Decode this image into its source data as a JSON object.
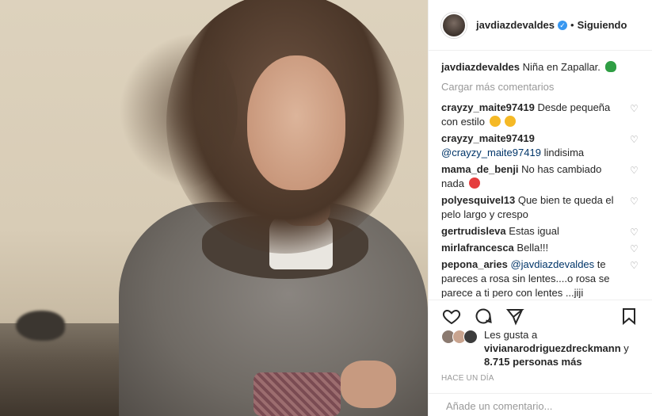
{
  "post": {
    "username": "javdiazdevaldes",
    "follow_status": "Siguiendo",
    "caption_text": "Niña en Zapallar."
  },
  "comments_section": {
    "load_more": "Cargar más comentarios",
    "comments": [
      {
        "user": "crayzy_maite97419",
        "mention": "",
        "text": "Desde pequeña con estilo"
      },
      {
        "user": "crayzy_maite97419",
        "mention": "@crayzy_maite97419",
        "text": "lindisima"
      },
      {
        "user": "mama_de_benji",
        "mention": "",
        "text": "No has cambiado nada"
      },
      {
        "user": "polyesquivel13",
        "mention": "",
        "text": "Que bien te queda el pelo largo y crespo"
      },
      {
        "user": "gertrudisleva",
        "mention": "",
        "text": "Estas igual"
      },
      {
        "user": "mirlafrancesca",
        "mention": "",
        "text": "Bella!!!"
      },
      {
        "user": "pepona_aries",
        "mention": "@javdiazdevaldes",
        "text": "te pareces a rosa sin lentes....o rosa se parece a ti pero con lentes ...jiji"
      }
    ]
  },
  "likes": {
    "prefix": "Les gusta a",
    "user": "vivianarodriguezdreckmann",
    "conj": "y",
    "count": "8.715 personas más"
  },
  "timestamp": "Hace un día",
  "add_comment": {
    "placeholder": "Añade un comentario..."
  },
  "icons": {
    "like": "heart-icon",
    "comment": "comment-icon",
    "share": "share-icon",
    "save": "bookmark-icon",
    "verified": "verified-badge-icon"
  },
  "colors": {
    "verified": "#3897f0",
    "text": "#262626",
    "muted": "#999999",
    "mention": "#003569"
  }
}
